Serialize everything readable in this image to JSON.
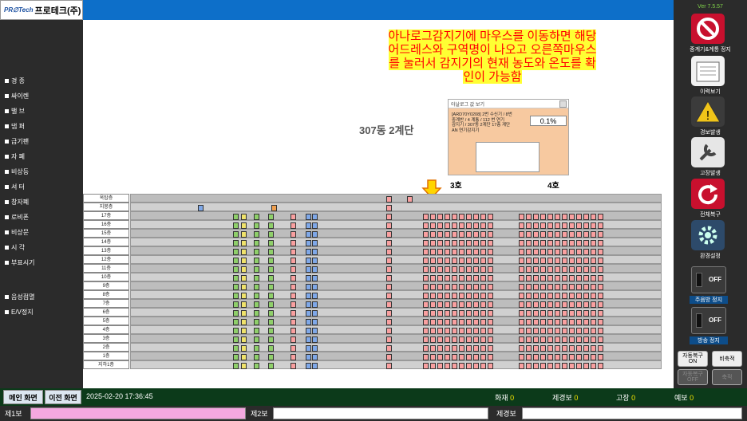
{
  "app": {
    "logo_mark": "PR∅Tech",
    "logo_name": "프로테크(주)",
    "version": "Ver 7.5.57"
  },
  "sidebar": {
    "items": [
      "경 종",
      "싸이렌",
      "밸 브",
      "댐 퍼",
      "급기팬",
      "자 폐",
      "비상등",
      "셔 터",
      "창자폐",
      "로비폰",
      "비상문",
      "시 각",
      "부표시기"
    ],
    "items2": [
      "음성점멸",
      "E/V정지"
    ]
  },
  "right": {
    "stop_label": "중계기&계통 정지",
    "history_label": "이력보기",
    "alarm_label": "경보발생",
    "fault_label": "고장발생",
    "reset_label": "전체복구",
    "setup_label": "환경설정",
    "switch_off": "OFF",
    "main_sound_label": "주음방 정지",
    "local_sound_label": "방송 정지",
    "auto_recover": "자동복구\nON",
    "noncall": "비축적",
    "auto_recover_off": "자동복구\nOFF",
    "accum": "축적"
  },
  "colors": {
    "brand": "#0d6fc9",
    "dark": "#2b2b2b",
    "status_green": "#0c3a1a",
    "highlight": "#ffff33"
  },
  "main": {
    "annotation": "아나로그감지기에 마우스를 이동하면 해당\n어드레스와 구역명이 나오고 오른쪽마우스\n를 눌러서 감지기의 현재 농도와 온도를 확\n인이 가능함",
    "building_title": "307동 2계단",
    "column_3": "3호",
    "column_4": "4호",
    "popup": {
      "title": "아날로그 값 보기",
      "text": "[ARD70Y0208] 2번 수신기 / 8번\n중계반 / 4 계통 / 112 번 연기\n감지기 / 307동 2계단 17층 계단\nAN 연기감지기",
      "value": "0.1%"
    },
    "floors": [
      "옥탑층",
      "지붕층",
      "17층",
      "16층",
      "15층",
      "14층",
      "13층",
      "12층",
      "11층",
      "10층",
      "9층",
      "8층",
      "7층",
      "6층",
      "5층",
      "4층",
      "3층",
      "2층",
      "1층",
      "지하1층"
    ]
  },
  "status": {
    "main_screen": "메인 화면",
    "prev_screen": "이전 화면",
    "datetime": "2025-02-20 17:36:45",
    "fire_label": "화재",
    "fire": "0",
    "pre_label": "제경보",
    "pre": "0",
    "fault_label": "고장",
    "fault": "0",
    "warn_label": "예보",
    "warn": "0"
  },
  "bottom": {
    "alarm1": "제1보",
    "alarm2": "제2보",
    "alarm_label": "제경보"
  }
}
